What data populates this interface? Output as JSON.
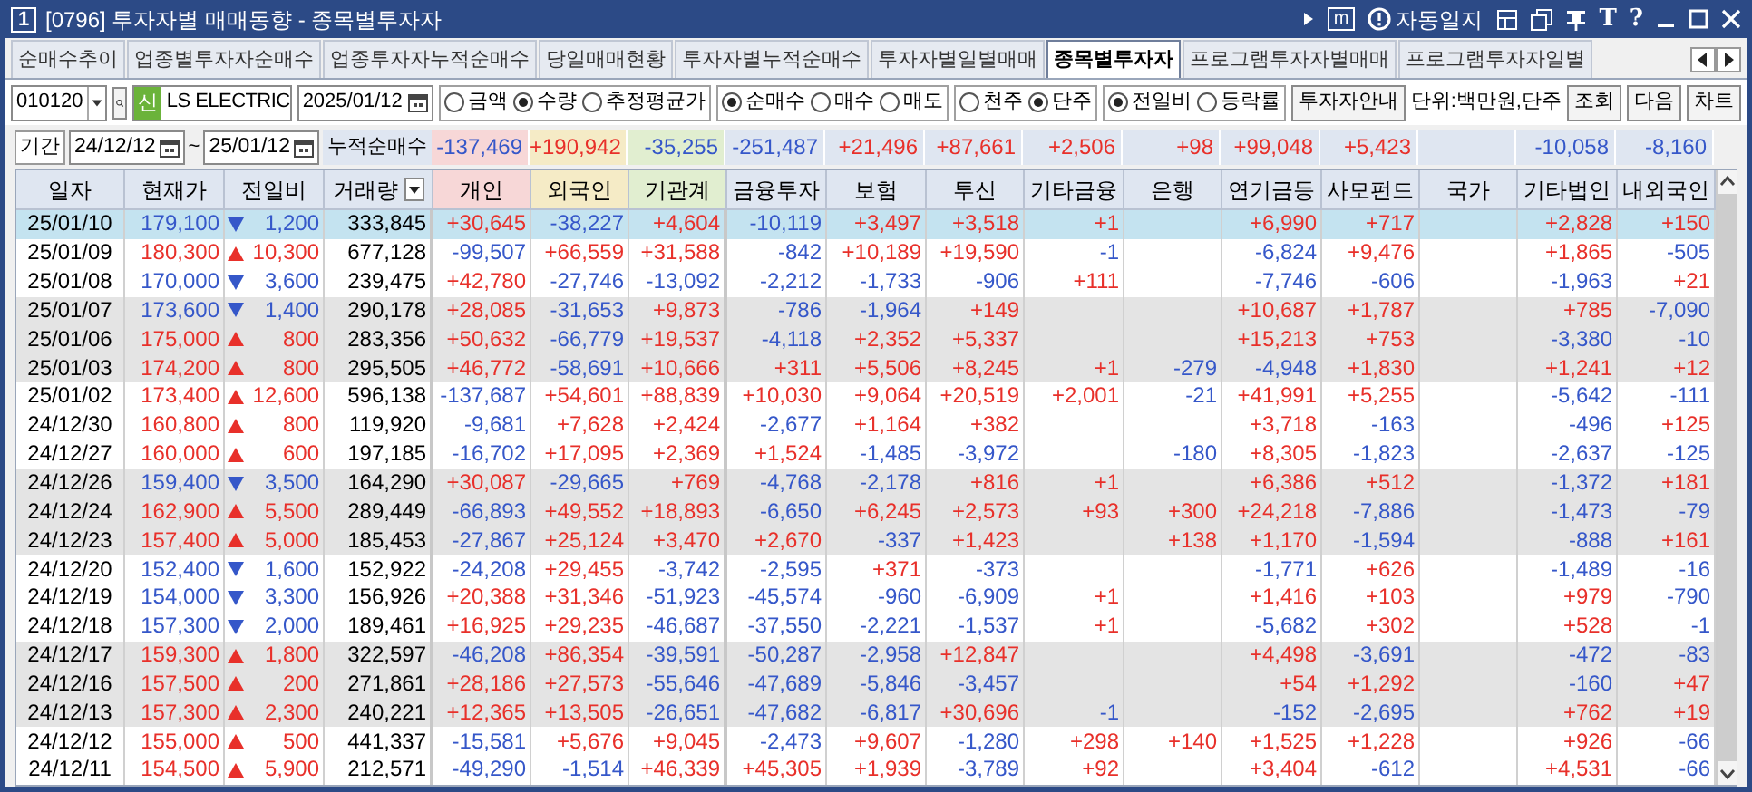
{
  "window": {
    "number": "1",
    "title": "[0796] 투자자별 매매동향 - 종목별투자자",
    "m_glyph": "m",
    "diary_label": "자동일지",
    "tool_glyphs": [
      "T",
      "?"
    ]
  },
  "tabs": [
    {
      "label": "순매수추이",
      "selected": false
    },
    {
      "label": "업종별투자자순매수",
      "selected": false
    },
    {
      "label": "업종투자자누적순매수",
      "selected": false
    },
    {
      "label": "당일매매현황",
      "selected": false
    },
    {
      "label": "투자자별누적순매수",
      "selected": false
    },
    {
      "label": "투자자별일별매매",
      "selected": false
    },
    {
      "label": "종목별투자자",
      "selected": true
    },
    {
      "label": "프로그램투자자별매매",
      "selected": false
    },
    {
      "label": "프로그램투자자일별",
      "selected": false
    }
  ],
  "toolbar": {
    "code": "010120",
    "new_badge": "신",
    "name": "LS ELECTRIC",
    "date": "2025/01/12",
    "radio_groups": [
      [
        {
          "label": "금액",
          "selected": false
        },
        {
          "label": "수량",
          "selected": true
        },
        {
          "label": "추정평균가",
          "selected": false
        }
      ],
      [
        {
          "label": "순매수",
          "selected": true
        },
        {
          "label": "매수",
          "selected": false
        },
        {
          "label": "매도",
          "selected": false
        }
      ],
      [
        {
          "label": "천주",
          "selected": false
        },
        {
          "label": "단주",
          "selected": true
        }
      ],
      [
        {
          "label": "전일비",
          "selected": true
        },
        {
          "label": "등락률",
          "selected": false
        }
      ]
    ],
    "guide_button": "투자자안내",
    "unit": "단위:백만원,단주",
    "buttons": [
      "조회",
      "다음",
      "차트"
    ]
  },
  "summary": {
    "period_label": "기간",
    "from": "24/12/12",
    "tilde": "~",
    "to": "25/01/12",
    "label": "누적순매수",
    "cells": [
      {
        "kind": "value",
        "value": "-137,469"
      },
      {
        "kind": "value",
        "value": "+190,942"
      },
      {
        "kind": "value",
        "value": "-35,255"
      },
      {
        "kind": "value",
        "value": "-251,487"
      },
      {
        "kind": "value",
        "value": "+21,496"
      },
      {
        "kind": "value",
        "value": "+87,661"
      },
      {
        "kind": "value",
        "value": "+2,506"
      },
      {
        "kind": "value",
        "value": "+98"
      },
      {
        "kind": "value",
        "value": "+99,048"
      },
      {
        "kind": "value",
        "value": "+5,423"
      },
      {
        "kind": "blank"
      },
      {
        "kind": "value",
        "value": "-10,058"
      },
      {
        "kind": "value",
        "value": "-8,160"
      }
    ]
  },
  "table": {
    "columns": [
      {
        "label": "일자",
        "color": "#dfe6f1"
      },
      {
        "label": "현재가",
        "color": "#dfe6f1"
      },
      {
        "label": "전일비",
        "color": "#dfe6f1"
      },
      {
        "label": "거래량",
        "color": "#dfe6f1",
        "sortable": true
      },
      {
        "label": "개인",
        "color": "#f7d7d7"
      },
      {
        "label": "외국인",
        "color": "#f5ebc6"
      },
      {
        "label": "기관계",
        "color": "#e1eed0"
      },
      {
        "label": "금융투자",
        "color": "#dfe6f1"
      },
      {
        "label": "보험",
        "color": "#dfe6f1"
      },
      {
        "label": "투신",
        "color": "#dfe6f1"
      },
      {
        "label": "기타금융",
        "color": "#dfe6f1"
      },
      {
        "label": "은행",
        "color": "#dfe6f1"
      },
      {
        "label": "연기금등",
        "color": "#dfe6f1"
      },
      {
        "label": "사모펀드",
        "color": "#dfe6f1"
      },
      {
        "label": "국가",
        "color": "#dfe6f1"
      },
      {
        "label": "기타법인",
        "color": "#dfe6f1"
      },
      {
        "label": "내외국인",
        "color": "#dfe6f1"
      }
    ],
    "rows": [
      {
        "selected": true,
        "shaded": false,
        "rising": false,
        "cells": [
          "25/01/10",
          "179,100",
          "1,200",
          "333,845",
          "+30,645",
          "-38,227",
          "+4,604",
          "-10,119",
          "+3,497",
          "+3,518",
          "+1",
          null,
          "+6,990",
          "+717",
          null,
          "+2,828",
          "+150"
        ]
      },
      {
        "selected": false,
        "shaded": false,
        "rising": true,
        "cells": [
          "25/01/09",
          "180,300",
          "10,300",
          "677,128",
          "-99,507",
          "+66,559",
          "+31,588",
          "-842",
          "+10,189",
          "+19,590",
          "-1",
          null,
          "-6,824",
          "+9,476",
          null,
          "+1,865",
          "-505"
        ]
      },
      {
        "selected": false,
        "shaded": false,
        "rising": false,
        "cells": [
          "25/01/08",
          "170,000",
          "3,600",
          "239,475",
          "+42,780",
          "-27,746",
          "-13,092",
          "-2,212",
          "-1,733",
          "-906",
          "+111",
          null,
          "-7,746",
          "-606",
          null,
          "-1,963",
          "+21"
        ]
      },
      {
        "selected": false,
        "shaded": true,
        "rising": false,
        "cells": [
          "25/01/07",
          "173,600",
          "1,400",
          "290,178",
          "+28,085",
          "-31,653",
          "+9,873",
          "-786",
          "-1,964",
          "+149",
          null,
          null,
          "+10,687",
          "+1,787",
          null,
          "+785",
          "-7,090"
        ]
      },
      {
        "selected": false,
        "shaded": true,
        "rising": true,
        "cells": [
          "25/01/06",
          "175,000",
          "800",
          "283,356",
          "+50,632",
          "-66,779",
          "+19,537",
          "-4,118",
          "+2,352",
          "+5,337",
          null,
          null,
          "+15,213",
          "+753",
          null,
          "-3,380",
          "-10"
        ]
      },
      {
        "selected": false,
        "shaded": true,
        "rising": true,
        "cells": [
          "25/01/03",
          "174,200",
          "800",
          "295,505",
          "+46,772",
          "-58,691",
          "+10,666",
          "+311",
          "+5,506",
          "+8,245",
          "+1",
          "-279",
          "-4,948",
          "+1,830",
          null,
          "+1,241",
          "+12"
        ]
      },
      {
        "selected": false,
        "shaded": false,
        "rising": true,
        "cells": [
          "25/01/02",
          "173,400",
          "12,600",
          "596,138",
          "-137,687",
          "+54,601",
          "+88,839",
          "+10,030",
          "+9,064",
          "+20,519",
          "+2,001",
          "-21",
          "+41,991",
          "+5,255",
          null,
          "-5,642",
          "-111"
        ]
      },
      {
        "selected": false,
        "shaded": false,
        "rising": true,
        "cells": [
          "24/12/30",
          "160,800",
          "800",
          "119,920",
          "-9,681",
          "+7,628",
          "+2,424",
          "-2,677",
          "+1,164",
          "+382",
          null,
          null,
          "+3,718",
          "-163",
          null,
          "-496",
          "+125"
        ]
      },
      {
        "selected": false,
        "shaded": false,
        "rising": true,
        "cells": [
          "24/12/27",
          "160,000",
          "600",
          "197,185",
          "-16,702",
          "+17,095",
          "+2,369",
          "+1,524",
          "-1,485",
          "-3,972",
          null,
          "-180",
          "+8,305",
          "-1,823",
          null,
          "-2,637",
          "-125"
        ]
      },
      {
        "selected": false,
        "shaded": true,
        "rising": false,
        "cells": [
          "24/12/26",
          "159,400",
          "3,500",
          "164,290",
          "+30,087",
          "-29,665",
          "+769",
          "-4,768",
          "-2,178",
          "+816",
          "+1",
          null,
          "+6,386",
          "+512",
          null,
          "-1,372",
          "+181"
        ]
      },
      {
        "selected": false,
        "shaded": true,
        "rising": true,
        "cells": [
          "24/12/24",
          "162,900",
          "5,500",
          "289,449",
          "-66,893",
          "+49,552",
          "+18,893",
          "-6,650",
          "+6,245",
          "+2,573",
          "+93",
          "+300",
          "+24,218",
          "-7,886",
          null,
          "-1,473",
          "-79"
        ]
      },
      {
        "selected": false,
        "shaded": true,
        "rising": true,
        "cells": [
          "24/12/23",
          "157,400",
          "5,000",
          "185,453",
          "-27,867",
          "+25,124",
          "+3,470",
          "+2,670",
          "-337",
          "+1,423",
          null,
          "+138",
          "+1,170",
          "-1,594",
          null,
          "-888",
          "+161"
        ]
      },
      {
        "selected": false,
        "shaded": false,
        "rising": false,
        "cells": [
          "24/12/20",
          "152,400",
          "1,600",
          "152,922",
          "-24,208",
          "+29,455",
          "-3,742",
          "-2,595",
          "+371",
          "-373",
          null,
          null,
          "-1,771",
          "+626",
          null,
          "-1,489",
          "-16"
        ]
      },
      {
        "selected": false,
        "shaded": false,
        "rising": false,
        "cells": [
          "24/12/19",
          "154,000",
          "3,300",
          "156,926",
          "+20,388",
          "+31,346",
          "-51,923",
          "-45,574",
          "-960",
          "-6,909",
          "+1",
          null,
          "+1,416",
          "+103",
          null,
          "+979",
          "-790"
        ]
      },
      {
        "selected": false,
        "shaded": false,
        "rising": false,
        "cells": [
          "24/12/18",
          "157,300",
          "2,000",
          "189,461",
          "+16,925",
          "+29,235",
          "-46,687",
          "-37,550",
          "-2,221",
          "-1,537",
          "+1",
          null,
          "-5,682",
          "+302",
          null,
          "+528",
          "-1"
        ]
      },
      {
        "selected": false,
        "shaded": true,
        "rising": true,
        "cells": [
          "24/12/17",
          "159,300",
          "1,800",
          "322,597",
          "-46,208",
          "+86,354",
          "-39,591",
          "-50,287",
          "-2,958",
          "+12,847",
          null,
          null,
          "+4,498",
          "-3,691",
          null,
          "-472",
          "-83"
        ]
      },
      {
        "selected": false,
        "shaded": true,
        "rising": true,
        "cells": [
          "24/12/16",
          "157,500",
          "200",
          "271,861",
          "+28,186",
          "+27,573",
          "-55,646",
          "-47,689",
          "-5,846",
          "-3,457",
          null,
          null,
          "+54",
          "+1,292",
          null,
          "-160",
          "+47"
        ]
      },
      {
        "selected": false,
        "shaded": true,
        "rising": true,
        "cells": [
          "24/12/13",
          "157,300",
          "2,300",
          "240,221",
          "+12,365",
          "+13,505",
          "-26,651",
          "-47,682",
          "-6,817",
          "+30,696",
          "-1",
          null,
          "-152",
          "-2,695",
          null,
          "+762",
          "+19"
        ]
      },
      {
        "selected": false,
        "shaded": false,
        "rising": true,
        "cells": [
          "24/12/12",
          "155,000",
          "500",
          "441,337",
          "-15,581",
          "+5,676",
          "+9,045",
          "-2,473",
          "+9,607",
          "-1,280",
          "+298",
          "+140",
          "+1,525",
          "+1,228",
          null,
          "+926",
          "-66"
        ]
      },
      {
        "selected": false,
        "shaded": false,
        "rising": true,
        "cells": [
          "24/12/11",
          "154,500",
          "5,900",
          "212,571",
          "-49,290",
          "-1,514",
          "+46,339",
          "+45,305",
          "+1,939",
          "-3,789",
          "+92",
          null,
          "+3,404",
          "-612",
          null,
          "+4,531",
          "-66"
        ]
      }
    ]
  }
}
